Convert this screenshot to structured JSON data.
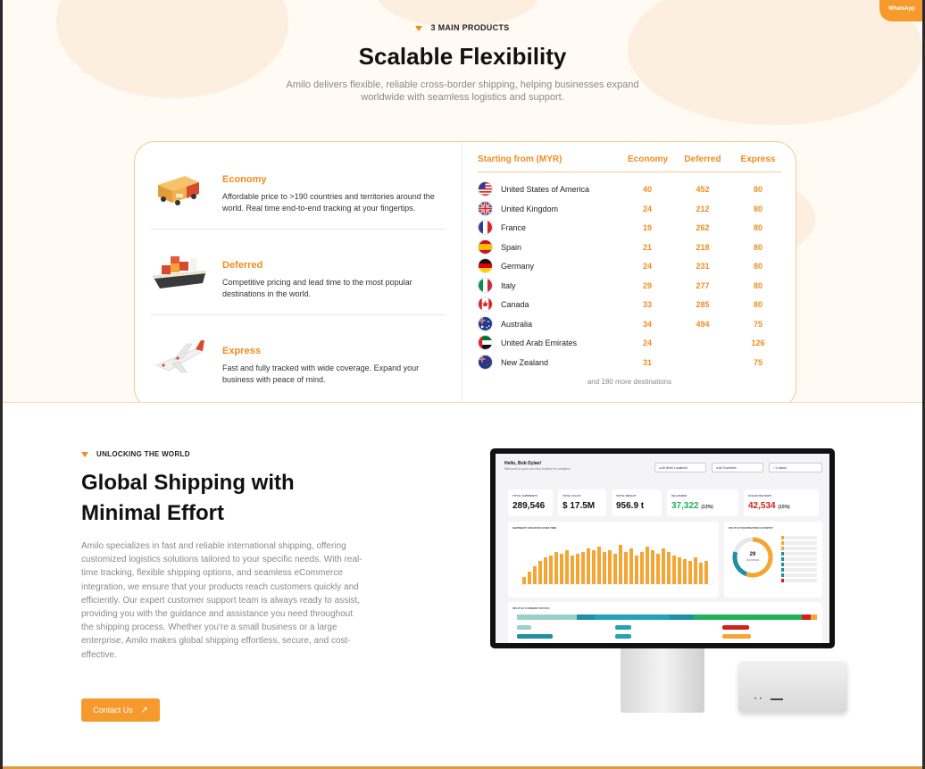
{
  "floating": {
    "whatsapp_label": "WhatsApp"
  },
  "products_section": {
    "eyebrow": "3 MAIN PRODUCTS",
    "title": "Scalable Flexibility",
    "subtitle": "Amilo delivers flexible, reliable cross-border shipping, helping businesses expand worldwide with seamless logistics and support.",
    "products": [
      {
        "title": "Economy",
        "description": "Affordable price to >190 countries and territories around the world. Real time end-to-end tracking at your fingertips."
      },
      {
        "title": "Deferred",
        "description": "Competitive pricing and lead time to the most popular destinations in the world."
      },
      {
        "title": "Express",
        "description": "Fast and fully tracked with wide coverage. Expand your business with peace of mind."
      }
    ],
    "table": {
      "headers": [
        "Starting from (MYR)",
        "Economy",
        "Deferred",
        "Express"
      ],
      "rows": [
        {
          "country": "United States of America",
          "flag": "us-flag-icon",
          "economy": "40",
          "deferred": "452",
          "express": "80"
        },
        {
          "country": "United Kingdom",
          "flag": "uk-flag-icon",
          "economy": "24",
          "deferred": "212",
          "express": "80"
        },
        {
          "country": "France",
          "flag": "france-flag-icon",
          "economy": "19",
          "deferred": "262",
          "express": "80"
        },
        {
          "country": "Spain",
          "flag": "spain-flag-icon",
          "economy": "21",
          "deferred": "218",
          "express": "80"
        },
        {
          "country": "Germany",
          "flag": "germany-flag-icon",
          "economy": "24",
          "deferred": "231",
          "express": "80"
        },
        {
          "country": "Italy",
          "flag": "italy-flag-icon",
          "economy": "29",
          "deferred": "277",
          "express": "80"
        },
        {
          "country": "Canada",
          "flag": "canada-flag-icon",
          "economy": "33",
          "deferred": "285",
          "express": "80"
        },
        {
          "country": "Australia",
          "flag": "australia-flag-icon",
          "economy": "34",
          "deferred": "494",
          "express": "75"
        },
        {
          "country": "United Arab Emirates",
          "flag": "uae-flag-icon",
          "economy": "24",
          "deferred": "",
          "express": "126"
        },
        {
          "country": "New Zealand",
          "flag": "new-zealand-flag-icon",
          "economy": "31",
          "deferred": "",
          "express": "75"
        }
      ],
      "footnote": "and 180 more destinations"
    }
  },
  "global_section": {
    "eyebrow": "UNLOCKING THE WORLD",
    "title_line1": "Global Shipping with",
    "title_line2": "Minimal Effort",
    "paragraph": "Amilo specializes in fast and reliable international shipping, offering customized logistics solutions tailored to your specific needs. With real-time tracking, flexible shipping options, and seamless eCommerce integration, we ensure that your products reach customers quickly and efficiently. Our expert customer support team is always ready to assist, providing you with the guidance and assistance you need throughout the shipping process. Whether you're a small business or a large enterprise, Amilo makes global shipping effortless, secure, and cost-effective.",
    "cta_label": "Contact Us",
    "cta_icon": "arrow-up-right-icon"
  },
  "dashboard": {
    "greeting": "Hello, Bob Dylan!",
    "greeting_sub": "Welcome to your one-stop location for analytics",
    "filters": [
      "All Work Locations",
      "All Countries",
      "Custom"
    ],
    "kpis": [
      {
        "label": "TOTAL SHIPMENTS",
        "value": "289,546",
        "suffix": ""
      },
      {
        "label": "TOTAL SALES",
        "value": "$ 17.5M",
        "suffix": ""
      },
      {
        "label": "TOTAL WEIGHT",
        "value": "956.9 t",
        "suffix": ""
      },
      {
        "label": "DELIVERED",
        "value": "37,322",
        "suffix": "(13%)"
      },
      {
        "label": "FAILED DELIVERY",
        "value": "42,534",
        "suffix": "(15%)"
      }
    ],
    "chart_title": "SHIPMENT CREATION OVER TIME",
    "donut_title": "SPLIT BY DESTINATION COUNTRY",
    "donut_value": "29",
    "donut_caption": "COUNTRIES",
    "status_title": "SPLIT BY CURRENT STATUS",
    "colors": {
      "accent": "#f79a2e",
      "delivered": "#20b15a",
      "failed": "#d0221c"
    }
  }
}
